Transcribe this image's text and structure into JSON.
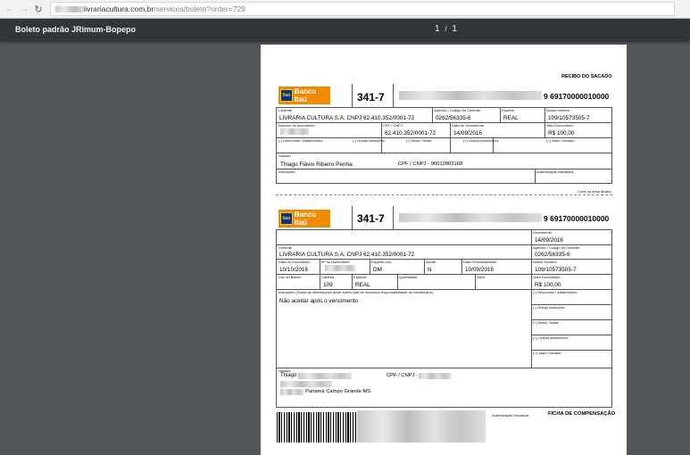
{
  "browser": {
    "url_host": "www.livrariacultura.com.br",
    "url_path": "/services/boleto?order=729"
  },
  "pdf": {
    "title": "Boleto padrão JRimum-Bopepo",
    "page_current": "1",
    "page_sep": "/",
    "page_total": "1"
  },
  "bank": {
    "logo_text": "Banco Itaú",
    "logo_mark": "Itaú",
    "code": "341-7"
  },
  "receipt": {
    "title": "RECIBO DO SACADO",
    "line_digits_end": "9 69170000010000",
    "cedente_label": "Cedente",
    "cedente_value": "LIVRARIA CULTURA S.A. CNPJ 62.410.352/0001-72",
    "agencia_label": "Agência / Código do Cedente",
    "agencia_value": "0262/56335-6",
    "especie_label": "Espécie",
    "especie_value": "REAL",
    "nosso_label": "Nosso número",
    "nosso_value": "109/10573505-7",
    "numdoc_label": "Número do documento",
    "cpf_label": "CPF / CNPJ",
    "cpf_value": "62.410.352/0001-72",
    "venc_label": "Data de Vencimento",
    "venc_value": "14/09/2016",
    "valor_label": "Valor Documento",
    "valor_value": "R$ 100,00",
    "desc_label": "(-) Descontos / Abatimentos",
    "outras_ded_label": "(-) Outras deduções",
    "mora_label": "(+) Mora / Multa",
    "outros_acr_label": "(+) Outros acréscimos",
    "cobrado_label": "(=) Valor Cobrado",
    "sacado_label": "Sacado",
    "sacado_value": "Thiago Flávio Ribeiro Penha",
    "sacado_cpf": "CPF / CNPJ - 96012803168",
    "instr_label": "Instruções",
    "auth_label": "Autenticação Mecânica",
    "cut_label": "Corte na linha abaixo"
  },
  "ficha": {
    "line_digits_end": "9 69170000010000",
    "venc_label": "Vencimento",
    "venc_value": "14/09/2016",
    "cedente_label": "Cedente",
    "cedente_value": "LIVRARIA CULTURA S.A. CNPJ 62.410.352/0001-72",
    "agencia_label": "Agência / Código do Cedente",
    "agencia_value": "0262/56335-6",
    "datadoc_label": "Data do Documento",
    "datadoc_value": "10/10/2016",
    "numdoc_label": "Nº do Documento",
    "espdoc_label": "Espécie Doc.",
    "espdoc_value": "DM",
    "aceite_label": "Aceite",
    "aceite_value": "N",
    "dataproc_label": "Data Processamento",
    "dataproc_value": "10/09/2016",
    "nosso_label": "Nosso Número",
    "nosso_value": "109/10573505-7",
    "uso_label": "Uso do Banco",
    "carteira_label": "Carteira",
    "carteira_value": "109",
    "especie_label": "Espécie",
    "especie_value": "REAL",
    "quant_label": "Quantidade",
    "valorun_label": "Valor",
    "valor_label": "Valor Documento",
    "valor_value": "R$ 100,00",
    "instr_label": "Instruções (Todas as informações deste boleto são de exclusiva responsabilidade do beneficiário)",
    "instr_value": "Não aceitar após o vencimento",
    "desc_label": "(-) Descontos / Abatimentos",
    "outras_ded_label": "(-) Outras deduções",
    "mora_label": "(+) Mora / Multa",
    "outros_acr_label": "(+) Outros acréscimos",
    "cobrado_label": "(=) Valor Cobrado",
    "sacado_label": "Sacado",
    "sacado_name": "Thiago",
    "sacado_cpf_label": "CPF / CNPJ -",
    "sacado_addr": "Panamá Campo Grande MS",
    "auth_label": "Autenticação Mecânica",
    "ficha_title": "FICHA DE COMPENSAÇÃO"
  }
}
